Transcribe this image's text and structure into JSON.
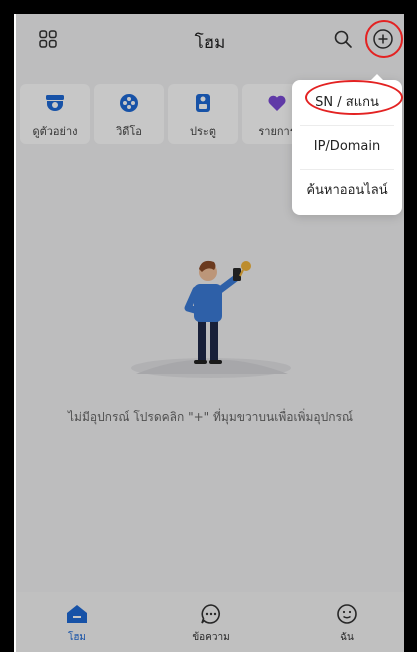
{
  "header": {
    "title": "โฮม",
    "icons": [
      "grid-icon",
      "search-icon",
      "add-circle-icon"
    ]
  },
  "quick_actions": [
    {
      "label": "ดูตัวอย่าง",
      "icon": "camera-icon"
    },
    {
      "label": "วิดีโอ",
      "icon": "video-icon"
    },
    {
      "label": "ประตู",
      "icon": "door-icon"
    },
    {
      "label": "รายการ",
      "icon": "heart-icon"
    }
  ],
  "empty_state": {
    "message": "ไม่มีอุปกรณ์ โปรดคลิก \"+\" ที่มุมขวาบนเพื่อเพิ่มอุปกรณ์"
  },
  "menu": {
    "items": [
      "SN / สแกน",
      "IP/Domain",
      "ค้นหาออนไลน์"
    ]
  },
  "tabbar": {
    "tabs": [
      {
        "label": "โฮม",
        "icon": "home-icon",
        "active": true
      },
      {
        "label": "ข้อความ",
        "icon": "message-icon",
        "active": false
      },
      {
        "label": "ฉัน",
        "icon": "me-icon",
        "active": false
      }
    ]
  },
  "colors": {
    "accent": "#1e6ad6",
    "annotation": "#e32222"
  }
}
